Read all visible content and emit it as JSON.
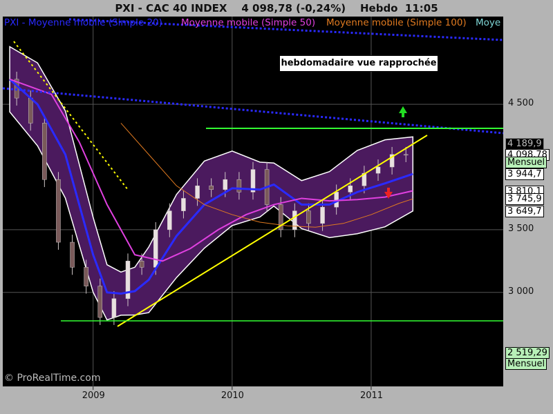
{
  "title": "PXI - CAC 40 INDEX    4 098,78 (-0,24%)    Hebdo  11:05",
  "annotation": "hebdomadaire vue rapprochée",
  "watermark": "© ProRealTime.com",
  "legend": [
    {
      "label": "PXI - Moyenne mobile (Simple 20)",
      "color": "#2a2aff"
    },
    {
      "label": "Moyenne mobile (Simple 50)",
      "color": "#e040e0"
    },
    {
      "label": "Moyenne mobile (Simple 100)",
      "color": "#e07a20"
    },
    {
      "label": "Moye",
      "color": "#7fd6d6"
    }
  ],
  "price_labels": [
    {
      "text": "4 189,9",
      "value": 4189.9,
      "bg": "#000000",
      "fg": "#bbbbbb",
      "border": "#888888"
    },
    {
      "text": "4 098,78",
      "value": 4098.78,
      "bg": "#ffffff",
      "fg": "#000000",
      "border": "#000000"
    },
    {
      "text": "Mensuel",
      "value": 4036,
      "bg": "#b8f0b8",
      "fg": "#000000",
      "border": "#000000"
    },
    {
      "text": "3 944,7",
      "value": 3944.7,
      "bg": "#ffffff",
      "fg": "#000000",
      "border": "#000000"
    },
    {
      "text": "3 810,1",
      "value": 3810.1,
      "bg": "#ffffff",
      "fg": "#000000",
      "border": "#000000"
    },
    {
      "text": "3 745,9",
      "value": 3745.9,
      "bg": "#ffffff",
      "fg": "#000000",
      "border": "#000000"
    },
    {
      "text": "3 649,7",
      "value": 3649.7,
      "bg": "#ffffff",
      "fg": "#000000",
      "border": "#000000"
    },
    {
      "text": "2 519,29",
      "value": 2519.29,
      "bg": "#b8f0b8",
      "fg": "#000000",
      "border": "#000000"
    },
    {
      "text": "Mensuel",
      "value": 2430,
      "bg": "#b8f0b8",
      "fg": "#000000",
      "border": "#000000"
    }
  ],
  "chart_data": {
    "type": "line",
    "title": "PXI - CAC 40 INDEX    4 098,78 (-0,24%)    Hebdo  11:05",
    "y_ticks": [
      {
        "label": "4 500",
        "value": 4500
      },
      {
        "label": "3 500",
        "value": 3500
      },
      {
        "label": "3 000",
        "value": 3000
      }
    ],
    "x_ticks": [
      {
        "label": "2009",
        "value": 2009.0
      },
      {
        "label": "2010",
        "value": 2010.0
      },
      {
        "label": "2011",
        "value": 2011.0
      }
    ],
    "ylim": [
      2250,
      5200
    ],
    "xlim": [
      2008.35,
      2011.95
    ],
    "grid": true,
    "series": [
      {
        "name": "CAC 40",
        "color": "#ffffff",
        "x": [
          2008.4,
          2008.5,
          2008.6,
          2008.7,
          2008.8,
          2008.9,
          2009.0,
          2009.1,
          2009.2,
          2009.3,
          2009.4,
          2009.5,
          2009.6,
          2009.7,
          2009.8,
          2009.9,
          2010.0,
          2010.1,
          2010.2,
          2010.3,
          2010.4,
          2010.5,
          2010.6,
          2010.7,
          2010.8,
          2010.9,
          2011.0,
          2011.1,
          2011.2,
          2011.3
        ],
        "y": [
          4700,
          4550,
          4350,
          3900,
          3400,
          3200,
          3050,
          2800,
          2950,
          3250,
          3200,
          3500,
          3650,
          3750,
          3850,
          3820,
          3900,
          3800,
          3980,
          3700,
          3500,
          3650,
          3550,
          3680,
          3800,
          3850,
          3950,
          4000,
          4100,
          4098.78
        ]
      },
      {
        "name": "Moyenne mobile (Simple 20)",
        "color": "#2a2aff",
        "x": [
          2008.4,
          2008.6,
          2008.8,
          2009.0,
          2009.1,
          2009.2,
          2009.3,
          2009.4,
          2009.6,
          2009.8,
          2010.0,
          2010.2,
          2010.3,
          2010.5,
          2010.7,
          2010.9,
          2011.1,
          2011.3
        ],
        "y": [
          4700,
          4500,
          4100,
          3300,
          3000,
          2990,
          3010,
          3100,
          3450,
          3700,
          3830,
          3820,
          3860,
          3700,
          3700,
          3800,
          3870,
          3944.7
        ]
      },
      {
        "name": "Moyenne mobile (Simple 50)",
        "color": "#e040e0",
        "x": [
          2008.4,
          2008.7,
          2008.9,
          2009.1,
          2009.3,
          2009.5,
          2009.7,
          2009.9,
          2010.1,
          2010.3,
          2010.5,
          2010.7,
          2010.9,
          2011.1,
          2011.3
        ],
        "y": [
          4700,
          4580,
          4200,
          3700,
          3300,
          3250,
          3350,
          3500,
          3620,
          3700,
          3750,
          3730,
          3740,
          3760,
          3810.1
        ]
      },
      {
        "name": "Moyenne mobile (Simple 100)",
        "color": "#e07a20",
        "x": [
          2009.2,
          2009.4,
          2009.6,
          2009.8,
          2010.0,
          2010.2,
          2010.4,
          2010.6,
          2010.8,
          2011.0,
          2011.2,
          2011.3
        ],
        "y": [
          4350,
          4100,
          3850,
          3700,
          3620,
          3560,
          3530,
          3520,
          3550,
          3620,
          3710,
          3745.9
        ]
      }
    ],
    "annotations": [
      "hebdomadaire vue rapprochée"
    ]
  }
}
